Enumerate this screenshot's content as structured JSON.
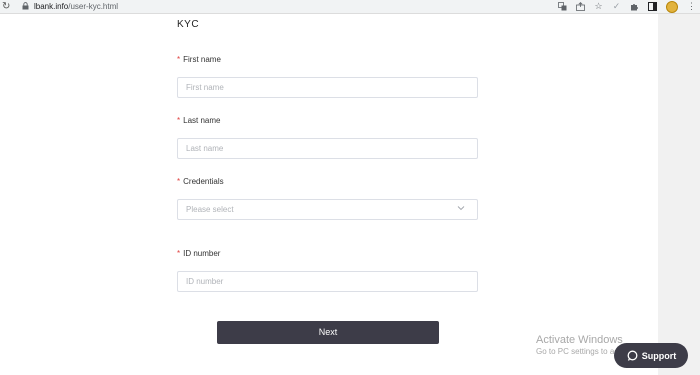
{
  "browser": {
    "url_host": "lbank.info",
    "url_path": "/user-kyc.html"
  },
  "form": {
    "title": "KYC",
    "first_name": {
      "label": "First name",
      "placeholder": "First name"
    },
    "last_name": {
      "label": "Last name",
      "placeholder": "Last name"
    },
    "credentials": {
      "label": "Credentials",
      "placeholder": "Please select"
    },
    "id_number": {
      "label": "ID number",
      "placeholder": "ID number"
    },
    "required_marker": "*",
    "next_label": "Next"
  },
  "watermark": {
    "line1": "Activate Windows",
    "line2": "Go to PC settings to activate Windows."
  },
  "support": {
    "label": "Support"
  },
  "icons": {
    "reload": "reload-icon",
    "lock": "lock-icon",
    "translate": "translate-icon",
    "share": "share-icon",
    "star": "star-icon",
    "check": "check-icon",
    "extensions": "puzzle-icon",
    "sidepanel": "sidepanel-icon",
    "chevron": "chevron-down-icon",
    "chat": "chat-icon"
  }
}
